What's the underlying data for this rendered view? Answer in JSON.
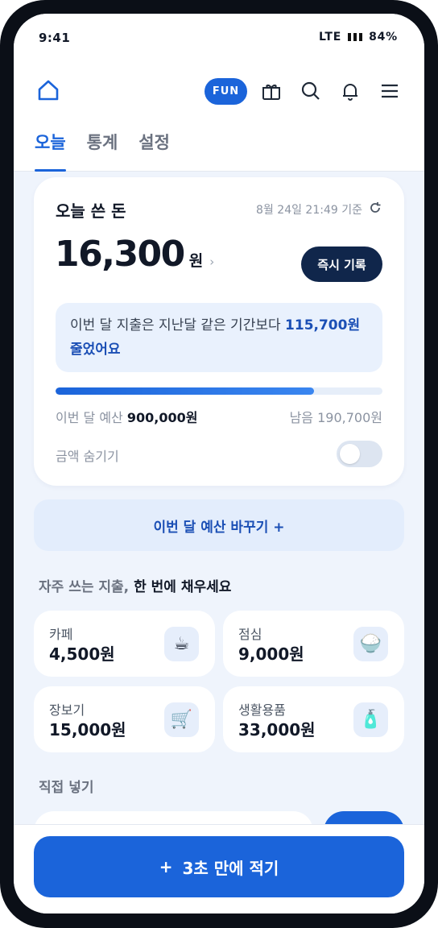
{
  "status_bar": {
    "time": "9:41",
    "network": "LTE",
    "battery": "84%"
  },
  "header": {
    "fun_label": "FUN",
    "icons": [
      "home-icon",
      "gift-icon",
      "search-icon",
      "bell-icon",
      "menu-icon"
    ],
    "tabs": [
      {
        "label": "오늘",
        "active": true
      },
      {
        "label": "통계",
        "active": false
      },
      {
        "label": "설정",
        "active": false
      }
    ]
  },
  "today_card": {
    "title": "오늘 쓴 돈",
    "as_of": "8월 24일 21:49 기준",
    "amount": "16,300",
    "unit": "원",
    "record_button": "즉시 기록",
    "compare_text": "이번 달 지출은 지난달 같은 기간보다",
    "compare_amount": "115,700원",
    "compare_suffix": "줄었어요",
    "budget_label": "이번 달 예산",
    "budget_amount": "900,000원",
    "remaining": "남음 190,700원",
    "budget_progress": 0.79,
    "hide_amount_label": "금액 숨기기",
    "hide_amount_on": false
  },
  "change_budget_label": "이번 달 예산 바꾸기 +",
  "frequent": {
    "title_muted": "자주 쓰는 지출,",
    "title_bold": "한 번에 채우세요",
    "items": [
      {
        "name": "카페",
        "price": "4,500원",
        "icon": "coffee-icon",
        "glyph": "☕"
      },
      {
        "name": "점심",
        "price": "9,000원",
        "icon": "rice-bowl-icon",
        "glyph": "🍚"
      },
      {
        "name": "장보기",
        "price": "15,000원",
        "icon": "shopping-cart-icon",
        "glyph": "🛒"
      },
      {
        "name": "생활용품",
        "price": "33,000원",
        "icon": "lotion-bottle-icon",
        "glyph": "🧴"
      }
    ]
  },
  "direct_entry_title": "직접 넣기",
  "cta": {
    "plus": "+",
    "label": "3초 만에 적기"
  },
  "colors": {
    "primary": "#1b64da",
    "dark_button": "#10264b",
    "background": "#eff4fc"
  }
}
